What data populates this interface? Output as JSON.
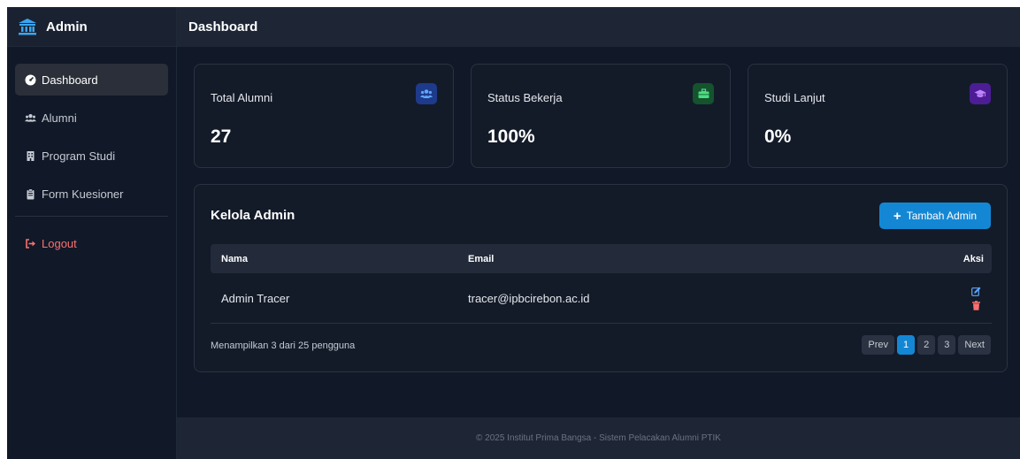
{
  "brand": {
    "title": "Admin",
    "icon": "university-icon"
  },
  "sidebar": {
    "items": [
      {
        "label": "Dashboard",
        "icon": "dashboard-icon",
        "active": true
      },
      {
        "label": "Alumni",
        "icon": "users-icon"
      },
      {
        "label": "Program Studi",
        "icon": "building-icon"
      },
      {
        "label": "Form Kuesioner",
        "icon": "clipboard-icon"
      }
    ],
    "logout": {
      "label": "Logout",
      "icon": "logout-icon",
      "color": "#f87171"
    }
  },
  "header": {
    "title": "Dashboard"
  },
  "stats": [
    {
      "title": "Total Alumni",
      "value": "27",
      "icon": "users-icon",
      "icon_bg": "#1e3a8a",
      "icon_color": "#60a5fa"
    },
    {
      "title": "Status Bekerja",
      "value": "100%",
      "icon": "briefcase-icon",
      "icon_bg": "#14532d",
      "icon_color": "#4ade80"
    },
    {
      "title": "Studi Lanjut",
      "value": "0%",
      "icon": "graduation-cap-icon",
      "icon_bg": "#4c1d95",
      "icon_color": "#c084fc"
    }
  ],
  "admin_panel": {
    "title": "Kelola Admin",
    "add_button": "Tambah Admin",
    "columns": [
      "Nama",
      "Email",
      "Aksi"
    ],
    "rows": [
      {
        "nama": "Admin Tracer",
        "email": "tracer@ipbcirebon.ac.id"
      }
    ],
    "summary": "Menampilkan 3 dari 25 pengguna",
    "pagination": {
      "prev": "Prev",
      "pages": [
        "1",
        "2",
        "3"
      ],
      "current": "1",
      "next": "Next"
    }
  },
  "footer": {
    "text": "© 2025 Institut Prima Bangsa - Sistem Pelacakan Alumni PTIK"
  },
  "colors": {
    "accent": "#1487d4",
    "sidebar_bg": "#111827",
    "topbar_bg": "#1e2636",
    "danger": "#f87171"
  }
}
